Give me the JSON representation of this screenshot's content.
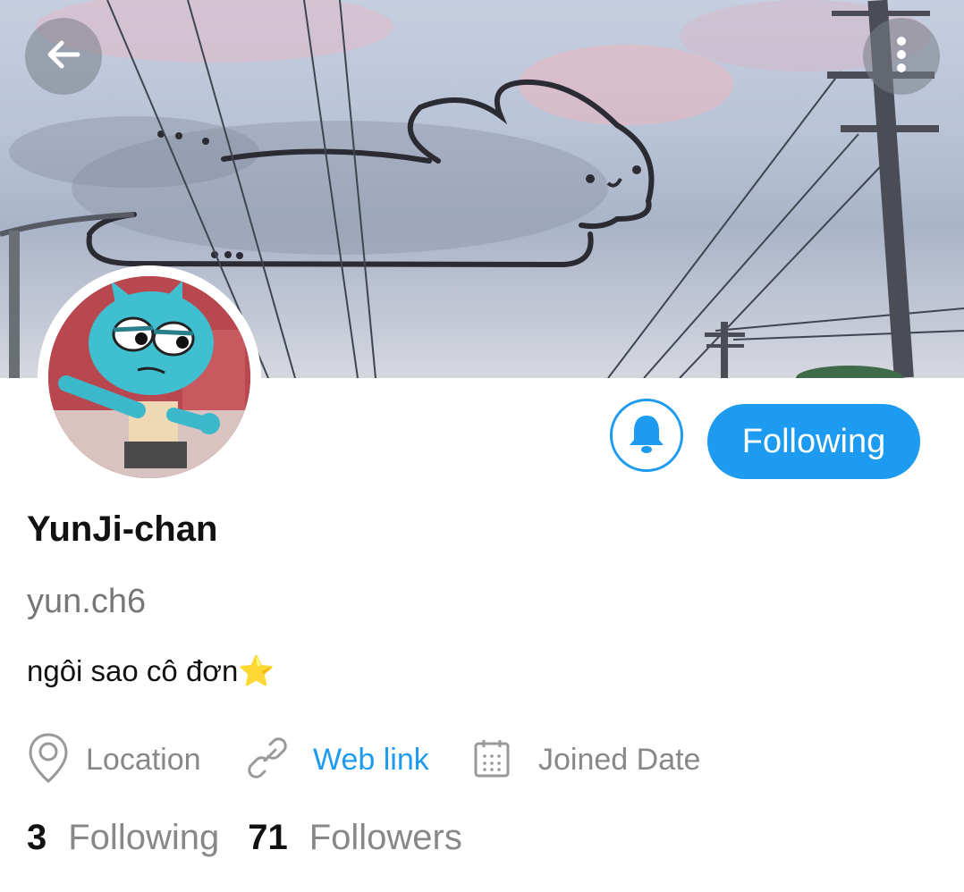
{
  "header": {
    "back_icon": "arrow-left-icon",
    "more_icon": "more-vertical-icon"
  },
  "profile": {
    "display_name": "YunJi-chan",
    "handle": "yun.ch6",
    "bio": "ngôi sao cô đơn⭐",
    "follow_button_label": "Following",
    "bell_icon": "bell-icon",
    "location_label": "Location",
    "web_link_label": "Web link",
    "joined_label": "Joined Date"
  },
  "stats": {
    "following_count": "3",
    "following_label": "Following",
    "followers_count": "71",
    "followers_label": "Followers"
  },
  "colors": {
    "accent": "#1d9bf0",
    "muted_text": "#888888",
    "primary_text": "#111111"
  }
}
